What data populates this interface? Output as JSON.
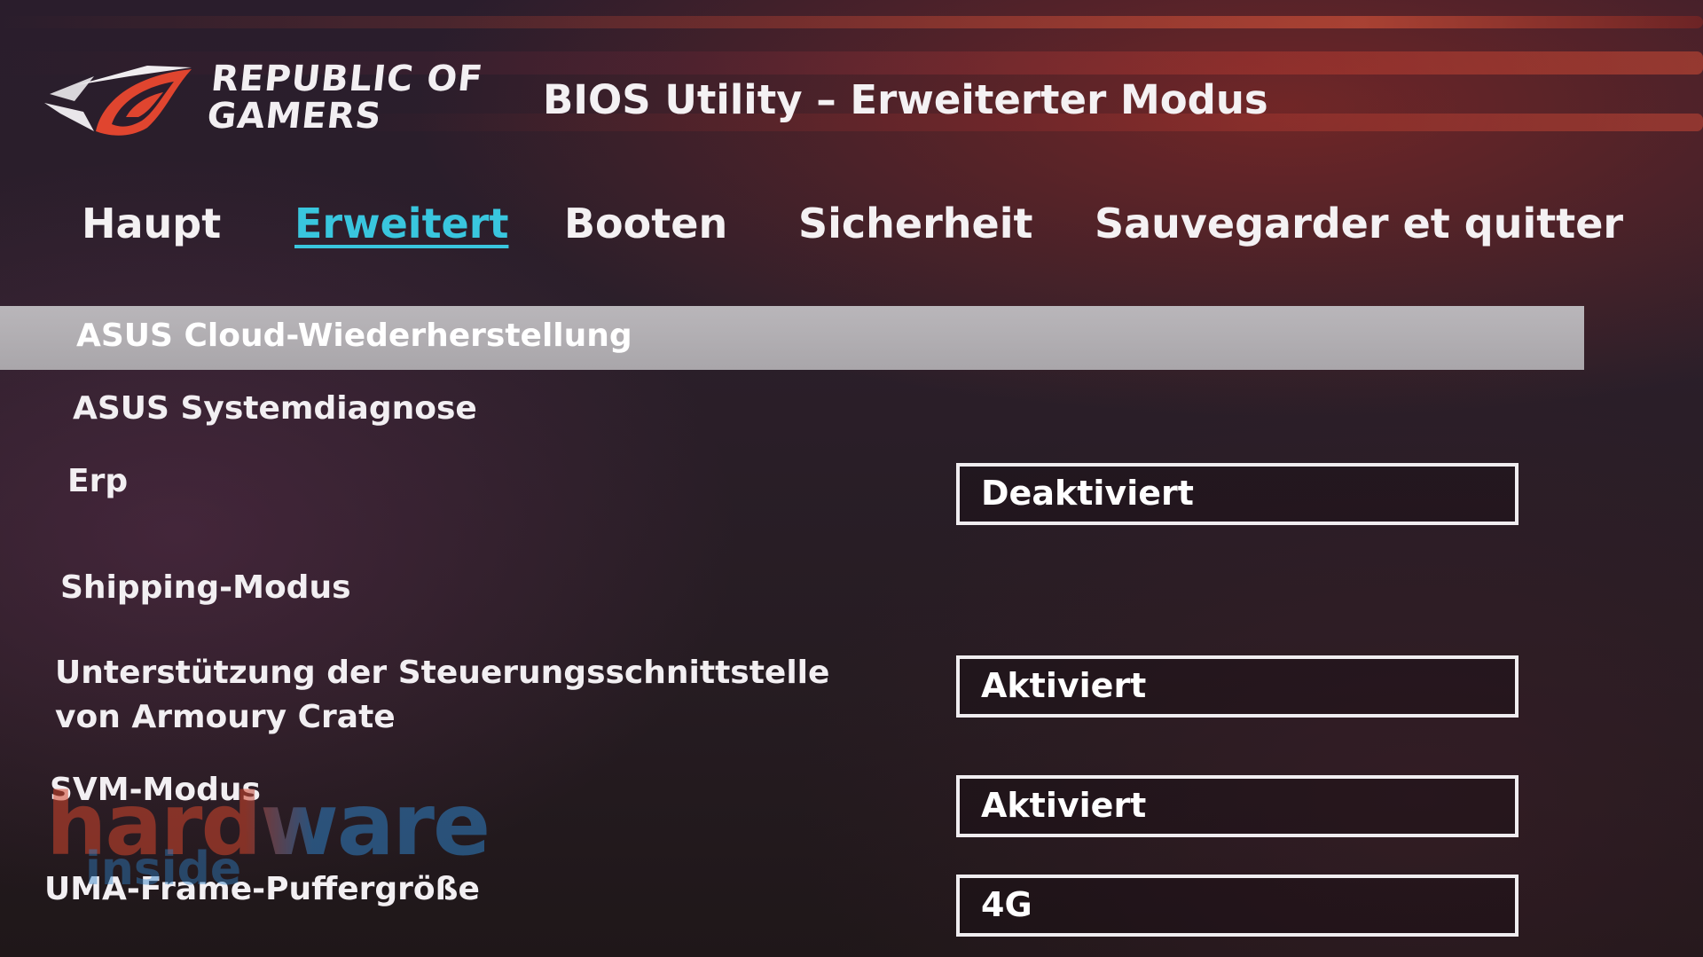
{
  "header": {
    "brand_line1": "REPUBLIC OF",
    "brand_line2": "GAMERS",
    "title": "BIOS Utility – Erweiterter Modus"
  },
  "tabs": [
    {
      "label": "Haupt",
      "active": false
    },
    {
      "label": "Erweitert",
      "active": true
    },
    {
      "label": "Booten",
      "active": false
    },
    {
      "label": "Sicherheit",
      "active": false
    },
    {
      "label": "Sauvegarder et quitter",
      "active": false
    }
  ],
  "settings": [
    {
      "label": "ASUS Cloud-Wiederherstellung",
      "value": null,
      "selected": true
    },
    {
      "label": "ASUS Systemdiagnose",
      "value": null
    },
    {
      "label": "Erp",
      "value": "Deaktiviert"
    },
    {
      "label": "Shipping-Modus",
      "value": null
    },
    {
      "label": "Unterstützung der Steuerungsschnittstelle von Armoury Crate",
      "value": "Aktiviert"
    },
    {
      "label": "SVM-Modus",
      "value": "Aktiviert"
    },
    {
      "label": "UMA-Frame-Puffergröße",
      "value": "4G"
    }
  ],
  "watermark": {
    "main": "hardware",
    "sub": "inside"
  },
  "colors": {
    "active_tab": "#39c6de",
    "highlight_bar": "#b9b6ba",
    "logo_red": "#e0452f"
  }
}
